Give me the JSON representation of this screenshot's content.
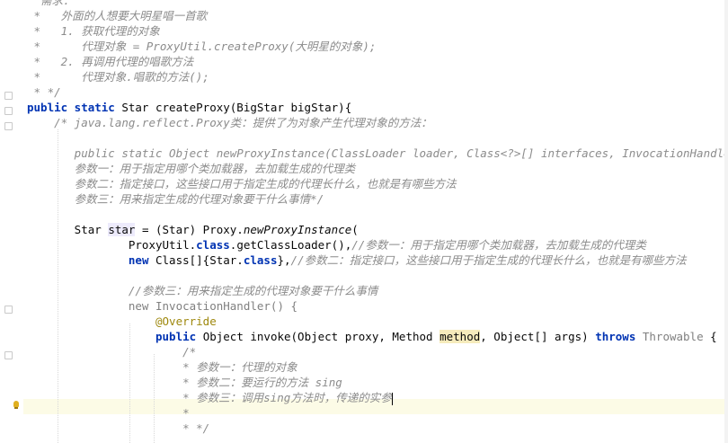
{
  "editor": {
    "lines": [
      {
        "id": "l0",
        "parts": [
          {
            "c": "cm",
            "t": "  需求："
          }
        ]
      },
      {
        "id": "l1",
        "parts": [
          {
            "c": "cm",
            "t": " *   外面的人想要大明星唱一首歌"
          }
        ]
      },
      {
        "id": "l2",
        "parts": [
          {
            "c": "cm",
            "t": " *   1. 获取代理的对象"
          }
        ]
      },
      {
        "id": "l3",
        "parts": [
          {
            "c": "cm",
            "t": " *      代理对象 = ProxyUtil.createProxy(大明星的对象);"
          }
        ]
      },
      {
        "id": "l4",
        "parts": [
          {
            "c": "cm",
            "t": " *   2. 再调用代理的唱歌方法"
          }
        ]
      },
      {
        "id": "l5",
        "parts": [
          {
            "c": "cm",
            "t": " *      代理对象.唱歌的方法();"
          }
        ]
      },
      {
        "id": "l6",
        "parts": [
          {
            "c": "cm",
            "t": " * */"
          }
        ]
      },
      {
        "id": "l7",
        "parts": [
          {
            "c": "kw",
            "t": "public static "
          },
          {
            "c": "",
            "t": "Star createProxy(BigStar bigStar){"
          }
        ]
      },
      {
        "id": "l8",
        "parts": [
          {
            "c": "cm",
            "t": "    /* java.lang.reflect.Proxy类：提供了为对象产生代理对象的方法："
          }
        ]
      },
      {
        "id": "l9",
        "parts": [
          {
            "c": "cm",
            "t": ""
          }
        ]
      },
      {
        "id": "l10",
        "parts": [
          {
            "c": "cm",
            "t": "       public static Object newProxyInstance(ClassLoader loader, Class<?>[] interfaces, InvocationHandler h)"
          }
        ]
      },
      {
        "id": "l11",
        "parts": [
          {
            "c": "cm",
            "t": "       参数一：用于指定用哪个类加载器，去加载生成的代理类"
          }
        ]
      },
      {
        "id": "l12",
        "parts": [
          {
            "c": "cm",
            "t": "       参数二：指定接口，这些接口用于指定生成的代理长什么，也就是有哪些方法"
          }
        ]
      },
      {
        "id": "l13",
        "parts": [
          {
            "c": "cm",
            "t": "       参数三：用来指定生成的代理对象要干什么事情*/"
          }
        ]
      },
      {
        "id": "l14",
        "parts": [
          {
            "c": "",
            "t": ""
          }
        ]
      },
      {
        "id": "l15",
        "parts": [
          {
            "c": "",
            "t": "       Star "
          },
          {
            "c": "hl2",
            "t": "star"
          },
          {
            "c": "",
            "t": " = (Star) Proxy."
          },
          {
            "c": "it",
            "t": "newProxyInstance"
          },
          {
            "c": "",
            "t": "("
          }
        ]
      },
      {
        "id": "l16",
        "parts": [
          {
            "c": "",
            "t": "               ProxyUtil."
          },
          {
            "c": "kw",
            "t": "class"
          },
          {
            "c": "",
            "t": ".getClassLoader(),"
          },
          {
            "c": "cmz",
            "t": "//参数一：用于指定用哪个类加载器，去加载生成的代理类"
          }
        ]
      },
      {
        "id": "l17",
        "parts": [
          {
            "c": "",
            "t": "               "
          },
          {
            "c": "kw",
            "t": "new "
          },
          {
            "c": "",
            "t": "Class[]{Star."
          },
          {
            "c": "kw",
            "t": "class"
          },
          {
            "c": "",
            "t": "},"
          },
          {
            "c": "cmz",
            "t": "//参数二：指定接口，这些接口用于指定生成的代理长什么，也就是有哪些方法"
          }
        ]
      },
      {
        "id": "l18",
        "parts": [
          {
            "c": "",
            "t": ""
          }
        ]
      },
      {
        "id": "l19",
        "parts": [
          {
            "c": "cmz",
            "t": "               //参数三：用来指定生成的代理对象要干什么事情"
          }
        ]
      },
      {
        "id": "l20",
        "parts": [
          {
            "c": "gr",
            "t": "               new InvocationHandler() {"
          }
        ]
      },
      {
        "id": "l21",
        "parts": [
          {
            "c": "ann",
            "t": "                   @Override"
          }
        ]
      },
      {
        "id": "l22",
        "parts": [
          {
            "c": "",
            "t": "                   "
          },
          {
            "c": "kw",
            "t": "public "
          },
          {
            "c": "",
            "t": "Object invoke(Object proxy, Method "
          },
          {
            "c": "hl",
            "t": "method"
          },
          {
            "c": "",
            "t": ", Object[] args) "
          },
          {
            "c": "kw",
            "t": "throws "
          },
          {
            "c": "gr",
            "t": "Throwable"
          },
          {
            "c": "",
            "t": " {"
          }
        ]
      },
      {
        "id": "l23",
        "parts": [
          {
            "c": "cm",
            "t": "                       /*"
          }
        ]
      },
      {
        "id": "l24",
        "parts": [
          {
            "c": "cm",
            "t": "                       * 参数一：代理的对象"
          }
        ]
      },
      {
        "id": "l25",
        "parts": [
          {
            "c": "cm",
            "t": "                       * 参数二：要运行的方法 sing"
          }
        ]
      },
      {
        "id": "l26",
        "parts": [
          {
            "c": "cm",
            "t": "                       * 参数三：调用sing方法时，传递的实参"
          }
        ]
      },
      {
        "id": "l27",
        "parts": [
          {
            "c": "cm",
            "t": "                       *"
          }
        ]
      },
      {
        "id": "l28",
        "parts": [
          {
            "c": "cm",
            "t": "                       * */"
          }
        ]
      }
    ]
  },
  "icons": {
    "gutter_bulb": "lightbulb-icon",
    "fold": "fold-marker-icon"
  }
}
